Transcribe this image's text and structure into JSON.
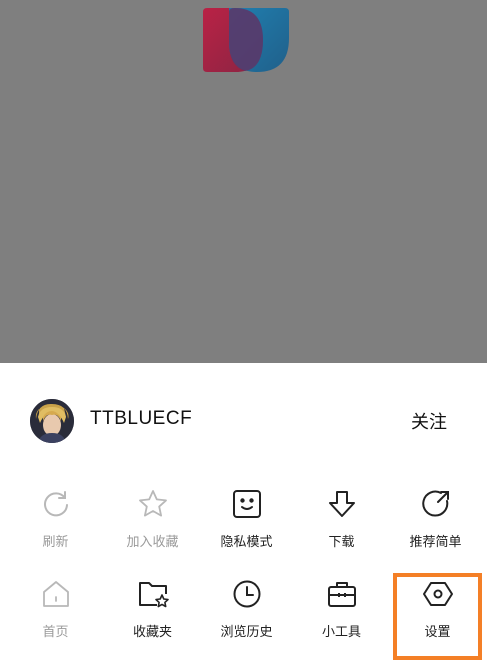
{
  "profile": {
    "username": "TTBLUECF",
    "follow_label": "关注"
  },
  "menu": {
    "row1": [
      {
        "label": "刷新",
        "icon": "refresh-icon",
        "enabled": false
      },
      {
        "label": "加入收藏",
        "icon": "star-icon",
        "enabled": false
      },
      {
        "label": "隐私模式",
        "icon": "privacy-face-icon",
        "enabled": true
      },
      {
        "label": "下载",
        "icon": "download-arrow-icon",
        "enabled": true
      },
      {
        "label": "推荐简单",
        "icon": "share-arrow-icon",
        "enabled": true
      }
    ],
    "row2": [
      {
        "label": "首页",
        "icon": "home-icon",
        "enabled": false
      },
      {
        "label": "收藏夹",
        "icon": "favorites-folder-icon",
        "enabled": true
      },
      {
        "label": "浏览历史",
        "icon": "clock-icon",
        "enabled": true
      },
      {
        "label": "小工具",
        "icon": "toolbox-icon",
        "enabled": true
      },
      {
        "label": "设置",
        "icon": "settings-hexagon-icon",
        "enabled": true
      }
    ]
  },
  "colors": {
    "overlay": "#7f7f7f",
    "highlight": "#f47f26",
    "disabled_icon": "#b8b8b8",
    "active_icon": "#222222"
  }
}
